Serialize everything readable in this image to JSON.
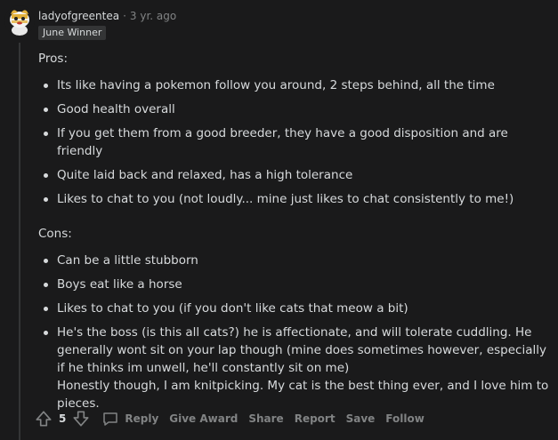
{
  "comment": {
    "username": "ladyofgreentea",
    "separator": "·",
    "time": "3 yr. ago",
    "flair": "June Winner",
    "pros_heading": "Pros:",
    "pros": [
      "Its like having a pokemon follow you around, 2 steps behind, all the time",
      "Good health overall",
      "If you get them from a good breeder, they have a good disposition and are friendly",
      "Quite laid back and relaxed, has a high tolerance",
      "Likes to chat to you (not loudly... mine just likes to chat consistently to me!)"
    ],
    "cons_heading": "Cons:",
    "cons": [
      "Can be a little stubborn",
      "Boys eat like a horse",
      "Likes to chat to you (if you don't like cats that meow a bit)",
      "He's the boss (is this all cats?) he is affectionate, and will tolerate cuddling. He generally wont sit on your lap though (mine does sometimes however, especially if he thinks im unwell, he'll constantly sit on me)"
    ],
    "closing": "Honestly though, I am knitpicking. My cat is the best thing ever, and I love him to pieces."
  },
  "actions": {
    "vote_count": "5",
    "reply": "Reply",
    "give_award": "Give Award",
    "share": "Share",
    "report": "Report",
    "save": "Save",
    "follow": "Follow"
  },
  "icons": {
    "upvote": "arrow-up-icon",
    "downvote": "arrow-down-icon",
    "reply": "comment-bubble-icon"
  },
  "colors": {
    "background": "#1a1a1b",
    "text": "#d7dadc",
    "muted": "#818384",
    "flair_bg": "#343536"
  }
}
